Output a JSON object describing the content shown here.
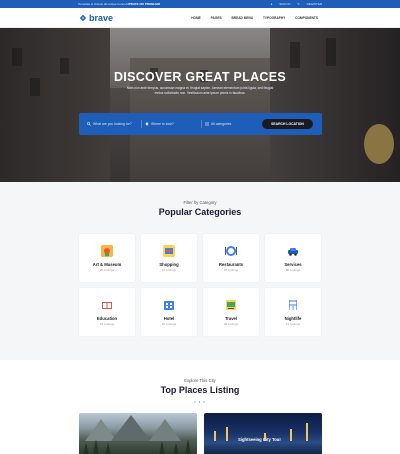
{
  "topbar": {
    "promo_prefix": "Template & Unlock all unique bonus",
    "promo_strong": "UPDATE NO PROBLEM",
    "sign_in": "SIGN IN",
    "register": "REGISTER"
  },
  "header": {
    "logo": "brave",
    "nav": [
      "HOME",
      "PAGES",
      "BREAD MENU",
      "TYPOGRAPHY",
      "COMPONENTS"
    ]
  },
  "hero": {
    "title": "DISCOVER GREAT PLACES",
    "subtitle": "Nam non ante tempus, accumsan magna et, feugiat sapien. Aenean elementum porta ligula, sed feugiat metus sollicitudin non. Vestibulum ante ipsum primis in faucibus.",
    "search": {
      "field1_placeholder": "What are you looking for?",
      "field2_placeholder": "Where to look?",
      "field3_placeholder": "All categories",
      "button": "SEARCH LOCATION"
    }
  },
  "categories": {
    "eyebrow": "Filter by Category",
    "title": "Popular Categories",
    "items": [
      {
        "name": "Art & Museum",
        "count": "26 Listings",
        "icon": "museum-icon"
      },
      {
        "name": "Shopping",
        "count": "16 Listings",
        "icon": "shopping-icon"
      },
      {
        "name": "Restaurants",
        "count": "22 Listings",
        "icon": "restaurant-icon"
      },
      {
        "name": "Services",
        "count": "80 Listings",
        "icon": "car-icon"
      },
      {
        "name": "Education",
        "count": "16 Listings",
        "icon": "book-icon"
      },
      {
        "name": "Hotel",
        "count": "26 Listings",
        "icon": "hotel-icon"
      },
      {
        "name": "Travel",
        "count": "42 Listings",
        "icon": "travel-icon"
      },
      {
        "name": "Nightlife",
        "count": "14 Listings",
        "icon": "nightlife-icon"
      }
    ]
  },
  "listing": {
    "eyebrow": "Explore This City",
    "title": "Top Places Listing",
    "dots": "• • •",
    "cards": [
      {
        "tag": ""
      },
      {
        "tag": "Sightseeing City Tour"
      }
    ]
  },
  "colors": {
    "brand": "#1e5db8",
    "dark_button": "#1a1a24",
    "section_bg": "#f5f6f8"
  }
}
